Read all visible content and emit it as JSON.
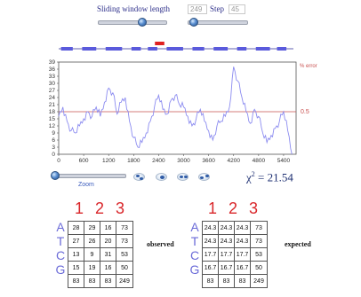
{
  "controls": {
    "window_label": "Sliding window length",
    "window_value": "249",
    "step_label": "Step",
    "step_value": "45",
    "window_slider_fraction": 0.65,
    "step_slider_fraction": 0.09
  },
  "error_label": "% error",
  "threshold_label": "0.5",
  "zoom_label": "Zoom",
  "zoom_buttons": [
    "zoom-in-icon",
    "zoom-out-icon",
    "zoom-left-icon",
    "zoom-right-icon"
  ],
  "chi_square": {
    "symbol": "χ",
    "exponent": "2",
    "value": "= 21.54"
  },
  "column_headers": [
    "1",
    "2",
    "3"
  ],
  "row_labels": [
    "A",
    "T",
    "C",
    "G"
  ],
  "observed": {
    "label": "observed",
    "rows": [
      [
        "28",
        "29",
        "16",
        "73"
      ],
      [
        "27",
        "26",
        "20",
        "73"
      ],
      [
        "13",
        "9",
        "31",
        "53"
      ],
      [
        "15",
        "19",
        "16",
        "50"
      ],
      [
        "83",
        "83",
        "83",
        "249"
      ]
    ]
  },
  "expected": {
    "label": "expected",
    "rows": [
      [
        "24.3",
        "24.3",
        "24.3",
        "73"
      ],
      [
        "24.3",
        "24.3",
        "24.3",
        "73"
      ],
      [
        "17.7",
        "17.7",
        "17.7",
        "53"
      ],
      [
        "16.7",
        "16.7",
        "16.7",
        "50"
      ],
      [
        "83",
        "83",
        "83",
        "249"
      ]
    ]
  },
  "colors": {
    "line": "#8c8cf0",
    "threshold": "#c8504f",
    "marker": "#e02020",
    "header_numbers": "#d9262a",
    "row_letters": "#6b6bd8"
  },
  "chart_data": {
    "type": "line",
    "xlim": [
      0,
      5700
    ],
    "ylim": [
      0,
      39
    ],
    "x_ticks": [
      "0",
      "600",
      "1200",
      "1800",
      "2400",
      "3000",
      "3600",
      "4200",
      "4800",
      "5400"
    ],
    "y_ticks": [
      "0",
      "3",
      "6",
      "9",
      "12",
      "15",
      "18",
      "21",
      "24",
      "27",
      "30",
      "33",
      "36",
      "39"
    ],
    "threshold": 18,
    "grid": false,
    "x": [
      0,
      100,
      200,
      300,
      400,
      500,
      600,
      700,
      800,
      900,
      1000,
      1100,
      1200,
      1300,
      1400,
      1500,
      1600,
      1700,
      1800,
      1900,
      2000,
      2100,
      2200,
      2300,
      2400,
      2500,
      2600,
      2700,
      2800,
      2900,
      3000,
      3100,
      3200,
      3300,
      3400,
      3500,
      3600,
      3700,
      3800,
      3900,
      4000,
      4100,
      4200,
      4300,
      4400,
      4500,
      4600,
      4700,
      4800,
      4900,
      5000,
      5100,
      5200,
      5300,
      5400,
      5500,
      5600
    ],
    "y": [
      16,
      20,
      14,
      10,
      9,
      12,
      15,
      18,
      16,
      20,
      16,
      22,
      28,
      26,
      17,
      22,
      24,
      14,
      7,
      3,
      5,
      9,
      14,
      20,
      25,
      19,
      17,
      23,
      25,
      21,
      20,
      16,
      12,
      15,
      19,
      14,
      10,
      6,
      12,
      14,
      16,
      20,
      37,
      31,
      24,
      18,
      13,
      19,
      16,
      9,
      5,
      8,
      11,
      14,
      18,
      10,
      0
    ]
  },
  "overview_bar": {
    "line_color": "#5a5adc",
    "selection_start_fraction": 0.41,
    "selection_end_fraction": 0.45
  }
}
